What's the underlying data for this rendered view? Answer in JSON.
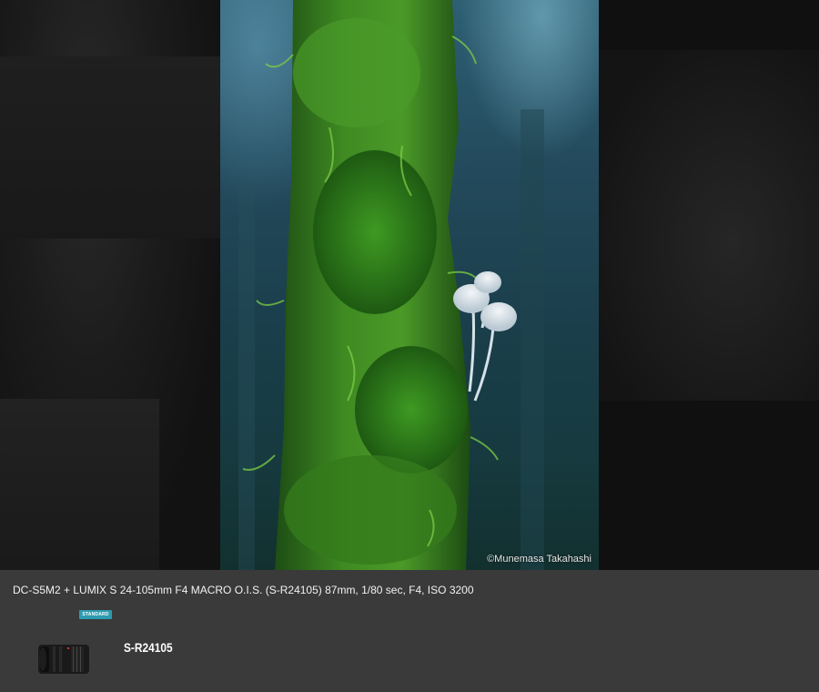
{
  "gallery": {
    "photo": {
      "alt_subject": "moss-covered tree trunk with white mushrooms",
      "credit": "©Munemasa Takahashi"
    },
    "caption": "DC-S5M2 + LUMIX S 24-105mm F4 MACRO O.I.S. (S-R24105) 87mm, 1/80 sec, F4, ISO 3200"
  },
  "lens": {
    "badge": "STANDARD",
    "model": "S-R24105"
  },
  "colors": {
    "panel_bg": "#3a3a3a",
    "badge_bg": "#2d9bb0",
    "stage_bg": "#141414"
  }
}
